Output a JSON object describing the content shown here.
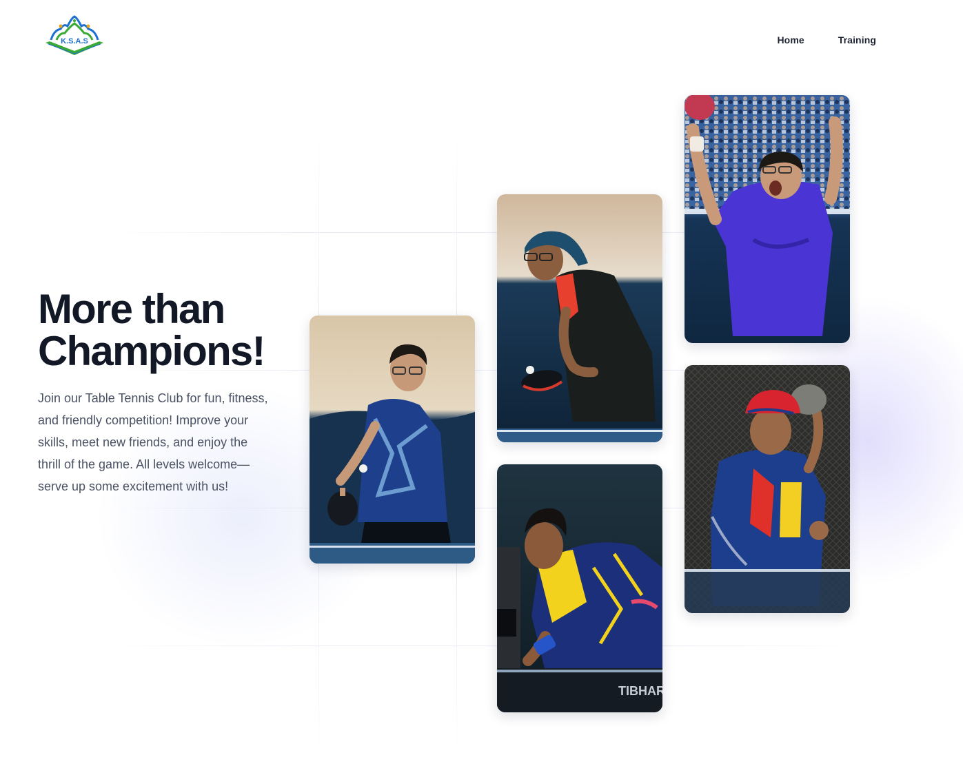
{
  "brand": {
    "logo_text": "K.S.A.S",
    "logo_icon": "club-logo-icon",
    "colors": {
      "green": "#3aa935",
      "blue": "#1d6fd0"
    }
  },
  "nav": {
    "items": [
      {
        "label": "Home"
      },
      {
        "label": "Training"
      }
    ]
  },
  "hero": {
    "title_line1": "More than",
    "title_line2": "Champions!",
    "body": "Join our Table Tennis Club for fun, fitness, and friendly competition! Improve your skills, meet new friends, and enjoy the thrill of the game. All levels welcome—serve up some excitement with us!"
  },
  "gallery": {
    "photos": [
      {
        "name": "player-photo-1",
        "description_icon": "table-tennis-player-image"
      },
      {
        "name": "player-photo-2",
        "description_icon": "table-tennis-player-image"
      },
      {
        "name": "player-photo-3",
        "description_icon": "table-tennis-player-image"
      },
      {
        "name": "player-photo-4",
        "description_icon": "table-tennis-player-image"
      },
      {
        "name": "player-photo-5",
        "description_icon": "table-tennis-player-image"
      }
    ]
  }
}
